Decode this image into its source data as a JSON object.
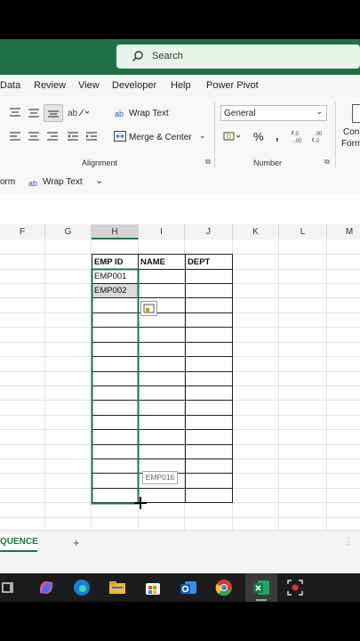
{
  "search": {
    "placeholder": "Search"
  },
  "menu": {
    "items": [
      "Data",
      "Review",
      "View",
      "Developer",
      "Help",
      "Power Pivot"
    ]
  },
  "ribbon": {
    "wrap_text": "Wrap Text",
    "merge_center": "Merge & Center",
    "alignment_label": "Alignment",
    "number_format": "General",
    "number_label": "Number",
    "cond_format_line1": "Con",
    "cond_format_line2": "Form"
  },
  "formula_bar": {
    "form_fragment": "orm",
    "wrap_text": "Wrap Text"
  },
  "columns": [
    "F",
    "G",
    "H",
    "I",
    "J",
    "K",
    "L",
    "M"
  ],
  "table": {
    "headers": [
      "EMP ID",
      "NAME",
      "DEPT"
    ],
    "rows": [
      "EMP001",
      "EMP002"
    ],
    "fill_tooltip": "EMP016"
  },
  "sheet": {
    "tab_label": "QUENCE",
    "add": "+"
  },
  "colors": {
    "excel_green": "#1f7145",
    "selection": "#217346"
  }
}
